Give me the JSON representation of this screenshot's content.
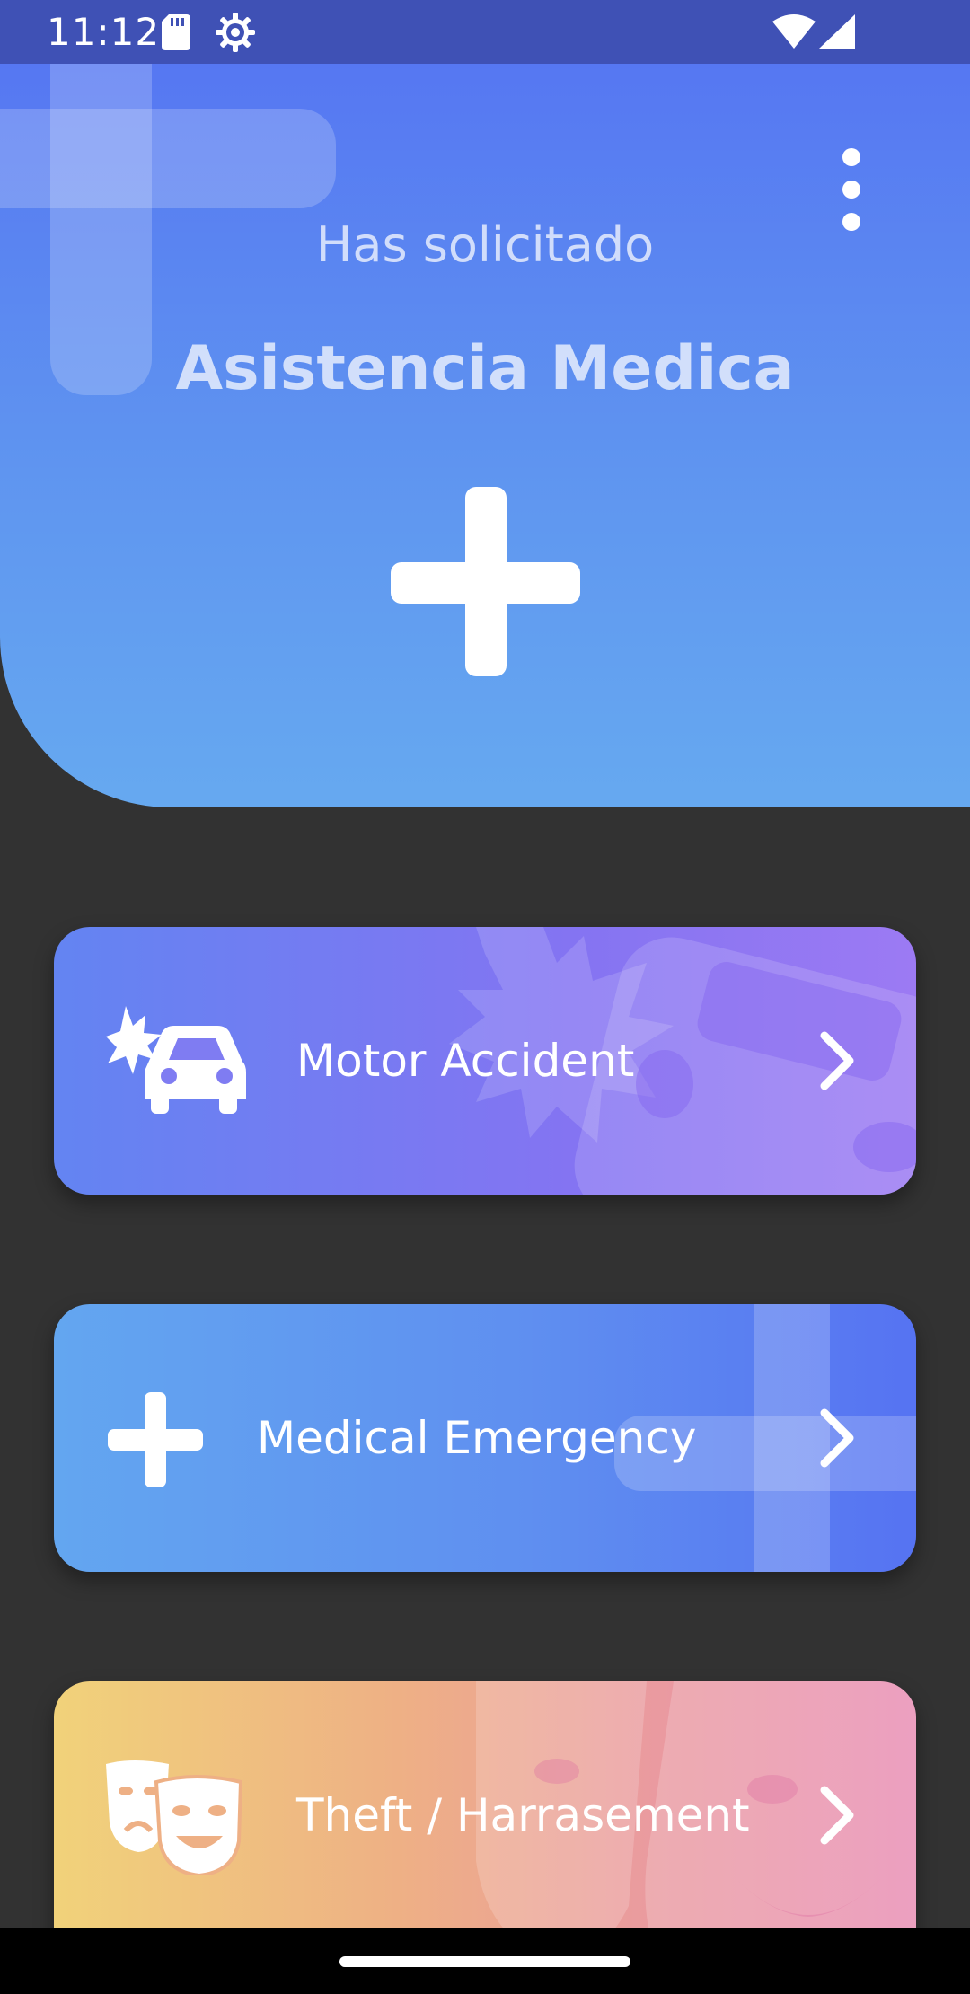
{
  "status_bar": {
    "time": "11:12",
    "icons": [
      "sd-card-icon",
      "settings-gear-icon",
      "wifi-icon",
      "cell-signal-icon"
    ]
  },
  "header": {
    "subtitle": "Has solicitado",
    "title": "Asistencia Medica",
    "icon": "medical-cross-icon",
    "menu_icon": "more-vert-icon"
  },
  "cards": [
    {
      "label": "Motor Accident",
      "icon": "car-crash-icon",
      "colors": [
        "#6384f2",
        "#9c7af3"
      ]
    },
    {
      "label": "Medical Emergency",
      "icon": "medical-cross-icon",
      "colors": [
        "#63a6f0",
        "#5673f2"
      ]
    },
    {
      "label": "Theft / Harrasement",
      "icon": "theater-masks-icon",
      "colors": [
        "#f1d27a",
        "#e88bb2"
      ]
    }
  ],
  "colors": {
    "status_bar": "#3f51b5",
    "background": "#323232",
    "header_top": "#5677f2",
    "header_bottom": "#66a9f0"
  }
}
